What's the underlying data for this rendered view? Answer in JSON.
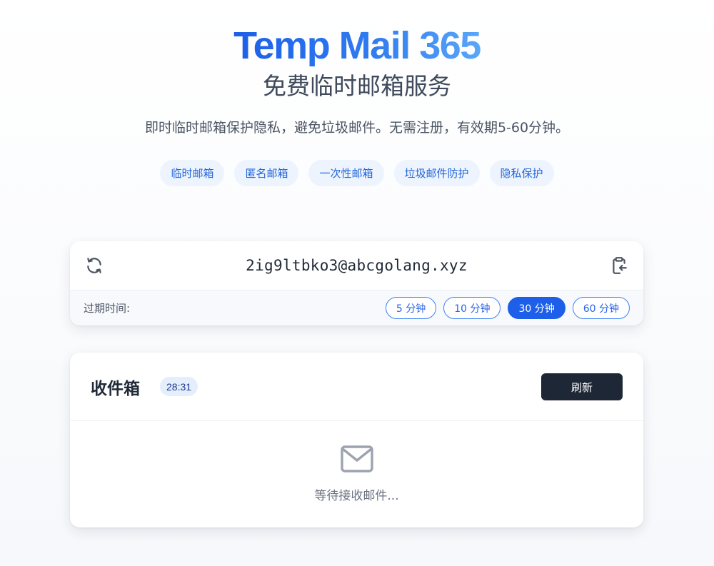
{
  "hero": {
    "title": "Temp Mail 365",
    "subtitle": "免费临时邮箱服务",
    "description": "即时临时邮箱保护隐私，避免垃圾邮件。无需注册，有效期5-60分钟。"
  },
  "tags": [
    "临时邮箱",
    "匿名邮箱",
    "一次性邮箱",
    "垃圾邮件防护",
    "隐私保护"
  ],
  "email": {
    "address": "2ig9ltbko3@abcgolang.xyz",
    "refresh_icon": "refresh-icon",
    "copy_icon": "clipboard-copy-icon"
  },
  "expiry": {
    "label": "过期时间:",
    "options": [
      "5 分钟",
      "10 分钟",
      "30 分钟",
      "60 分钟"
    ],
    "selected": "30 分钟"
  },
  "inbox": {
    "title": "收件箱",
    "timer": "28:31",
    "refresh_label": "刷新",
    "empty_text": "等待接收邮件...",
    "empty_icon": "envelope-icon"
  },
  "colors": {
    "accent": "#1d5fe8",
    "dark_button": "#1e2735",
    "tag_bg": "#edf4fe"
  }
}
